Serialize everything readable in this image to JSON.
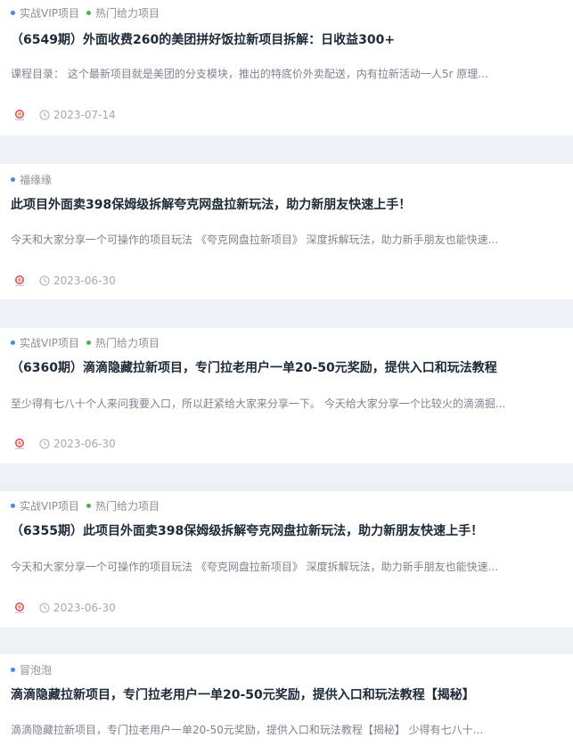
{
  "posts": [
    {
      "tags": [
        {
          "label": "实战VIP项目",
          "color": "#3a8ee6"
        },
        {
          "label": "热门给力项目",
          "color": "#45b34a"
        }
      ],
      "title": "（6549期）外面收费260的美团拼好饭拉新项目拆解：日收益300+",
      "desc": "课程目录： 这个最新项目就是美团的分支模块，推出的特底价外卖配送，内有拉新活动一人5r 原理...",
      "date": "2023-07-14"
    },
    {
      "tags": [
        {
          "label": "福缘缘",
          "color": "#3a8ee6"
        }
      ],
      "title": "此项目外面卖398保姆级拆解夸克网盘拉新玩法，助力新朋友快速上手！",
      "desc": "今天和大家分享一个可操作的项目玩法 《夸克网盘拉新项目》 深度拆解玩法，助力新手朋友也能快速...",
      "date": "2023-06-30"
    },
    {
      "tags": [
        {
          "label": "实战VIP项目",
          "color": "#3a8ee6"
        },
        {
          "label": "热门给力项目",
          "color": "#45b34a"
        }
      ],
      "title": "（6360期）滴滴隐藏拉新项目，专门拉老用户一单20-50元奖励，提供入口和玩法教程",
      "desc": "至少得有七八十个人来问我要入口，所以赶紧给大家来分享一下。 今天给大家分享一个比较火的滴滴掘...",
      "date": "2023-06-30"
    },
    {
      "tags": [
        {
          "label": "实战VIP项目",
          "color": "#3a8ee6"
        },
        {
          "label": "热门给力项目",
          "color": "#45b34a"
        }
      ],
      "title": "（6355期）此项目外面卖398保姆级拆解夸克网盘拉新玩法，助力新朋友快速上手！",
      "desc": "今天和大家分享一个可操作的项目玩法 《夸克网盘拉新项目》 深度拆解玩法，助力新手朋友也能快速...",
      "date": "2023-06-30"
    },
    {
      "tags": [
        {
          "label": "冒泡泡",
          "color": "#3a8ee6"
        }
      ],
      "title": "滴滴隐藏拉新项目，专门拉老用户一单20-50元奖励，提供入口和玩法教程【揭秘】",
      "desc": "滴滴隐藏拉新项目，专门拉老用户一单20-50元奖励，提供入口和玩法教程【揭秘】 少得有七八十...",
      "date": ""
    }
  ]
}
